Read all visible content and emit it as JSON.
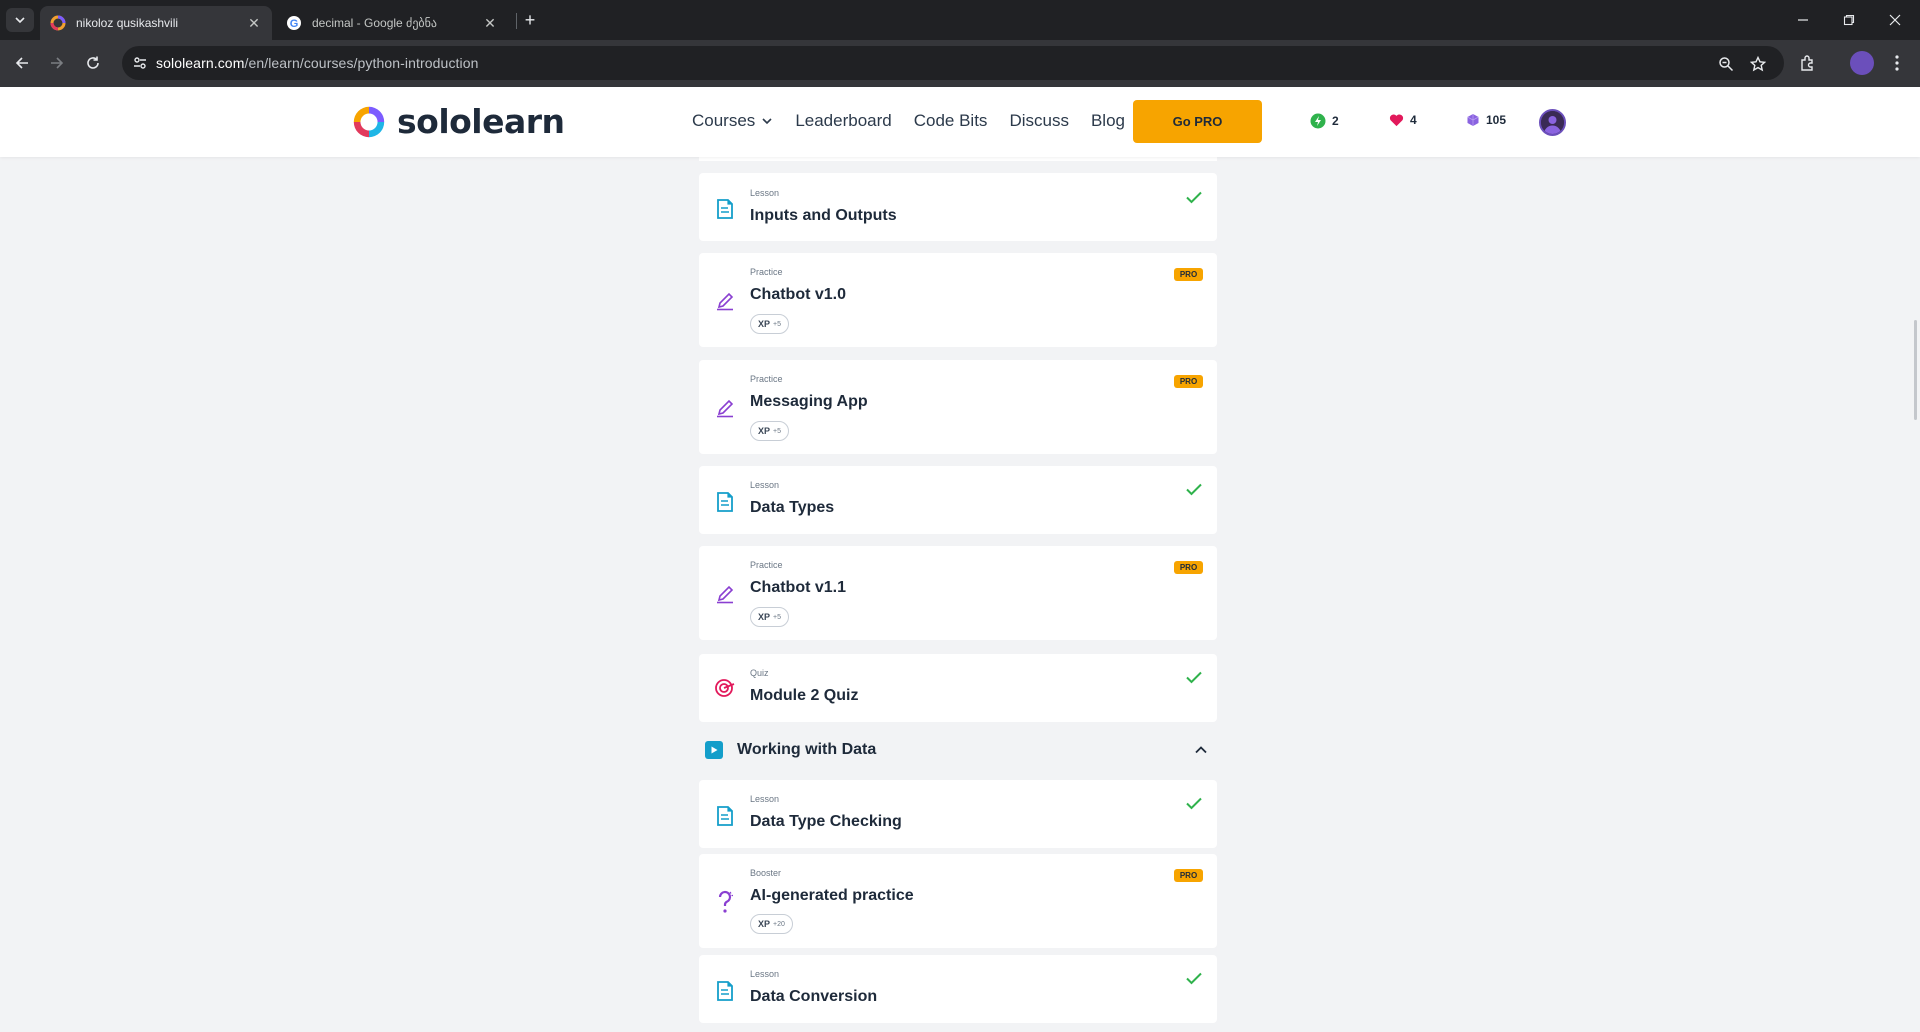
{
  "browser": {
    "tabs": [
      {
        "title": "nikoloz qusikashvili",
        "active": true
      },
      {
        "title": "decimal - Google ძებნა",
        "active": false
      }
    ],
    "url_host": "sololearn.com",
    "url_path": "/en/learn/courses/python-introduction"
  },
  "header": {
    "logo_text": "sololearn",
    "nav": [
      "Courses",
      "Leaderboard",
      "Code Bits",
      "Discuss",
      "Blog"
    ],
    "go_pro_label": "Go PRO",
    "streak": "2",
    "hearts": "4",
    "gems": "105",
    "accent_color": "#f7a400"
  },
  "items": [
    {
      "kind": "Lesson",
      "title": "Inputs and Outputs",
      "icon": "lesson-icon",
      "status": "completed"
    },
    {
      "kind": "Practice",
      "title": "Chatbot v1.0",
      "icon": "practice-icon",
      "status": "pro",
      "pro": "PRO",
      "xp": "XP",
      "xp_amount": "+5"
    },
    {
      "kind": "Practice",
      "title": "Messaging App",
      "icon": "practice-icon",
      "status": "pro",
      "pro": "PRO",
      "xp": "XP",
      "xp_amount": "+5"
    },
    {
      "kind": "Lesson",
      "title": "Data Types",
      "icon": "lesson-icon",
      "status": "completed"
    },
    {
      "kind": "Practice",
      "title": "Chatbot v1.1",
      "icon": "practice-icon",
      "status": "pro",
      "pro": "PRO",
      "xp": "XP",
      "xp_amount": "+5"
    },
    {
      "kind": "Quiz",
      "title": "Module 2 Quiz",
      "icon": "quiz-icon",
      "status": "completed"
    }
  ],
  "module": {
    "title": "Working with Data",
    "expanded": true
  },
  "module_items": [
    {
      "kind": "Lesson",
      "title": "Data Type Checking",
      "icon": "lesson-icon",
      "status": "completed"
    },
    {
      "kind": "Booster",
      "title": "AI-generated practice",
      "icon": "booster-icon",
      "status": "pro",
      "pro": "PRO",
      "xp": "XP",
      "xp_amount": "+20"
    },
    {
      "kind": "Lesson",
      "title": "Data Conversion",
      "icon": "lesson-icon",
      "status": "completed"
    }
  ]
}
